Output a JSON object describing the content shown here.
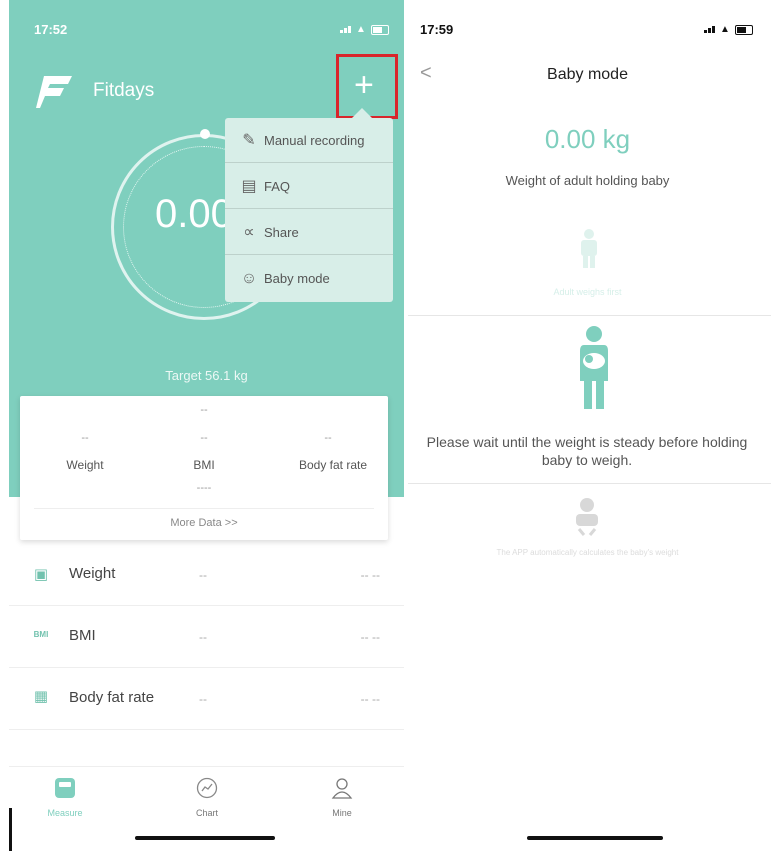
{
  "home": {
    "status_time": "17:52",
    "brand": "Fitdays",
    "add_label": "+",
    "weight_value": "0.00",
    "target": "Target 56.1 kg",
    "menu": [
      {
        "label": "Manual recording",
        "icon": "edit-icon"
      },
      {
        "label": "FAQ",
        "icon": "book-icon"
      },
      {
        "label": "Share",
        "icon": "share-icon"
      },
      {
        "label": "Baby mode",
        "icon": "baby-icon"
      }
    ],
    "card": {
      "top_value": "--",
      "weight_value": "--",
      "bmi_value": "--",
      "bodyfat_value": "--",
      "weight_label": "Weight",
      "bmi_label": "BMI",
      "bodyfat_label": "Body fat rate",
      "mid_value": "----",
      "more": "More Data >>"
    },
    "list": [
      {
        "icon_text": "",
        "label": "Weight",
        "v1": "--",
        "v2": "-- --"
      },
      {
        "icon_text": "BMI",
        "label": "BMI",
        "v1": "--",
        "v2": "-- --"
      },
      {
        "icon_text": "",
        "label": "Body fat rate",
        "v1": "--",
        "v2": "-- --"
      }
    ],
    "tabs": [
      {
        "label": "Measure",
        "icon": "scale-icon"
      },
      {
        "label": "Chart",
        "icon": "chart-icon"
      },
      {
        "label": "Mine",
        "icon": "user-icon"
      }
    ],
    "colors": {
      "accent": "#7fcfbe",
      "highlight": "#d8252b"
    }
  },
  "baby": {
    "status_time": "17:59",
    "back": "<",
    "title": "Baby mode",
    "weight": "0.00 kg",
    "subtitle": "Weight of adult holding baby",
    "faint_step1": "Adult weighs first",
    "instruction": "Please wait until the weight is steady before holding baby to weigh.",
    "faint_step3": "The APP automatically calculates the baby's weight"
  }
}
